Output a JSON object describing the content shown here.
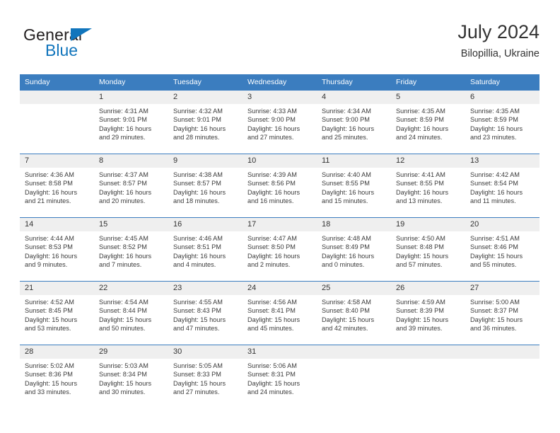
{
  "brand": {
    "name_dark": "General",
    "name_blue": "Blue",
    "accent_color": "#1175bc"
  },
  "header": {
    "title": "July 2024",
    "subtitle": "Bilopillia, Ukraine"
  },
  "theme": {
    "header_bg": "#3b7dbf",
    "daynum_bg": "#efefef",
    "text_color": "#333333"
  },
  "weekday_headers": [
    "Sunday",
    "Monday",
    "Tuesday",
    "Wednesday",
    "Thursday",
    "Friday",
    "Saturday"
  ],
  "weeks": [
    [
      {
        "day": "",
        "sunrise": "",
        "sunset": "",
        "daylight1": "",
        "daylight2": ""
      },
      {
        "day": "1",
        "sunrise": "Sunrise: 4:31 AM",
        "sunset": "Sunset: 9:01 PM",
        "daylight1": "Daylight: 16 hours",
        "daylight2": "and 29 minutes."
      },
      {
        "day": "2",
        "sunrise": "Sunrise: 4:32 AM",
        "sunset": "Sunset: 9:01 PM",
        "daylight1": "Daylight: 16 hours",
        "daylight2": "and 28 minutes."
      },
      {
        "day": "3",
        "sunrise": "Sunrise: 4:33 AM",
        "sunset": "Sunset: 9:00 PM",
        "daylight1": "Daylight: 16 hours",
        "daylight2": "and 27 minutes."
      },
      {
        "day": "4",
        "sunrise": "Sunrise: 4:34 AM",
        "sunset": "Sunset: 9:00 PM",
        "daylight1": "Daylight: 16 hours",
        "daylight2": "and 25 minutes."
      },
      {
        "day": "5",
        "sunrise": "Sunrise: 4:35 AM",
        "sunset": "Sunset: 8:59 PM",
        "daylight1": "Daylight: 16 hours",
        "daylight2": "and 24 minutes."
      },
      {
        "day": "6",
        "sunrise": "Sunrise: 4:35 AM",
        "sunset": "Sunset: 8:59 PM",
        "daylight1": "Daylight: 16 hours",
        "daylight2": "and 23 minutes."
      }
    ],
    [
      {
        "day": "7",
        "sunrise": "Sunrise: 4:36 AM",
        "sunset": "Sunset: 8:58 PM",
        "daylight1": "Daylight: 16 hours",
        "daylight2": "and 21 minutes."
      },
      {
        "day": "8",
        "sunrise": "Sunrise: 4:37 AM",
        "sunset": "Sunset: 8:57 PM",
        "daylight1": "Daylight: 16 hours",
        "daylight2": "and 20 minutes."
      },
      {
        "day": "9",
        "sunrise": "Sunrise: 4:38 AM",
        "sunset": "Sunset: 8:57 PM",
        "daylight1": "Daylight: 16 hours",
        "daylight2": "and 18 minutes."
      },
      {
        "day": "10",
        "sunrise": "Sunrise: 4:39 AM",
        "sunset": "Sunset: 8:56 PM",
        "daylight1": "Daylight: 16 hours",
        "daylight2": "and 16 minutes."
      },
      {
        "day": "11",
        "sunrise": "Sunrise: 4:40 AM",
        "sunset": "Sunset: 8:55 PM",
        "daylight1": "Daylight: 16 hours",
        "daylight2": "and 15 minutes."
      },
      {
        "day": "12",
        "sunrise": "Sunrise: 4:41 AM",
        "sunset": "Sunset: 8:55 PM",
        "daylight1": "Daylight: 16 hours",
        "daylight2": "and 13 minutes."
      },
      {
        "day": "13",
        "sunrise": "Sunrise: 4:42 AM",
        "sunset": "Sunset: 8:54 PM",
        "daylight1": "Daylight: 16 hours",
        "daylight2": "and 11 minutes."
      }
    ],
    [
      {
        "day": "14",
        "sunrise": "Sunrise: 4:44 AM",
        "sunset": "Sunset: 8:53 PM",
        "daylight1": "Daylight: 16 hours",
        "daylight2": "and 9 minutes."
      },
      {
        "day": "15",
        "sunrise": "Sunrise: 4:45 AM",
        "sunset": "Sunset: 8:52 PM",
        "daylight1": "Daylight: 16 hours",
        "daylight2": "and 7 minutes."
      },
      {
        "day": "16",
        "sunrise": "Sunrise: 4:46 AM",
        "sunset": "Sunset: 8:51 PM",
        "daylight1": "Daylight: 16 hours",
        "daylight2": "and 4 minutes."
      },
      {
        "day": "17",
        "sunrise": "Sunrise: 4:47 AM",
        "sunset": "Sunset: 8:50 PM",
        "daylight1": "Daylight: 16 hours",
        "daylight2": "and 2 minutes."
      },
      {
        "day": "18",
        "sunrise": "Sunrise: 4:48 AM",
        "sunset": "Sunset: 8:49 PM",
        "daylight1": "Daylight: 16 hours",
        "daylight2": "and 0 minutes."
      },
      {
        "day": "19",
        "sunrise": "Sunrise: 4:50 AM",
        "sunset": "Sunset: 8:48 PM",
        "daylight1": "Daylight: 15 hours",
        "daylight2": "and 57 minutes."
      },
      {
        "day": "20",
        "sunrise": "Sunrise: 4:51 AM",
        "sunset": "Sunset: 8:46 PM",
        "daylight1": "Daylight: 15 hours",
        "daylight2": "and 55 minutes."
      }
    ],
    [
      {
        "day": "21",
        "sunrise": "Sunrise: 4:52 AM",
        "sunset": "Sunset: 8:45 PM",
        "daylight1": "Daylight: 15 hours",
        "daylight2": "and 53 minutes."
      },
      {
        "day": "22",
        "sunrise": "Sunrise: 4:54 AM",
        "sunset": "Sunset: 8:44 PM",
        "daylight1": "Daylight: 15 hours",
        "daylight2": "and 50 minutes."
      },
      {
        "day": "23",
        "sunrise": "Sunrise: 4:55 AM",
        "sunset": "Sunset: 8:43 PM",
        "daylight1": "Daylight: 15 hours",
        "daylight2": "and 47 minutes."
      },
      {
        "day": "24",
        "sunrise": "Sunrise: 4:56 AM",
        "sunset": "Sunset: 8:41 PM",
        "daylight1": "Daylight: 15 hours",
        "daylight2": "and 45 minutes."
      },
      {
        "day": "25",
        "sunrise": "Sunrise: 4:58 AM",
        "sunset": "Sunset: 8:40 PM",
        "daylight1": "Daylight: 15 hours",
        "daylight2": "and 42 minutes."
      },
      {
        "day": "26",
        "sunrise": "Sunrise: 4:59 AM",
        "sunset": "Sunset: 8:39 PM",
        "daylight1": "Daylight: 15 hours",
        "daylight2": "and 39 minutes."
      },
      {
        "day": "27",
        "sunrise": "Sunrise: 5:00 AM",
        "sunset": "Sunset: 8:37 PM",
        "daylight1": "Daylight: 15 hours",
        "daylight2": "and 36 minutes."
      }
    ],
    [
      {
        "day": "28",
        "sunrise": "Sunrise: 5:02 AM",
        "sunset": "Sunset: 8:36 PM",
        "daylight1": "Daylight: 15 hours",
        "daylight2": "and 33 minutes."
      },
      {
        "day": "29",
        "sunrise": "Sunrise: 5:03 AM",
        "sunset": "Sunset: 8:34 PM",
        "daylight1": "Daylight: 15 hours",
        "daylight2": "and 30 minutes."
      },
      {
        "day": "30",
        "sunrise": "Sunrise: 5:05 AM",
        "sunset": "Sunset: 8:33 PM",
        "daylight1": "Daylight: 15 hours",
        "daylight2": "and 27 minutes."
      },
      {
        "day": "31",
        "sunrise": "Sunrise: 5:06 AM",
        "sunset": "Sunset: 8:31 PM",
        "daylight1": "Daylight: 15 hours",
        "daylight2": "and 24 minutes."
      },
      {
        "day": "",
        "sunrise": "",
        "sunset": "",
        "daylight1": "",
        "daylight2": ""
      },
      {
        "day": "",
        "sunrise": "",
        "sunset": "",
        "daylight1": "",
        "daylight2": ""
      },
      {
        "day": "",
        "sunrise": "",
        "sunset": "",
        "daylight1": "",
        "daylight2": ""
      }
    ]
  ]
}
